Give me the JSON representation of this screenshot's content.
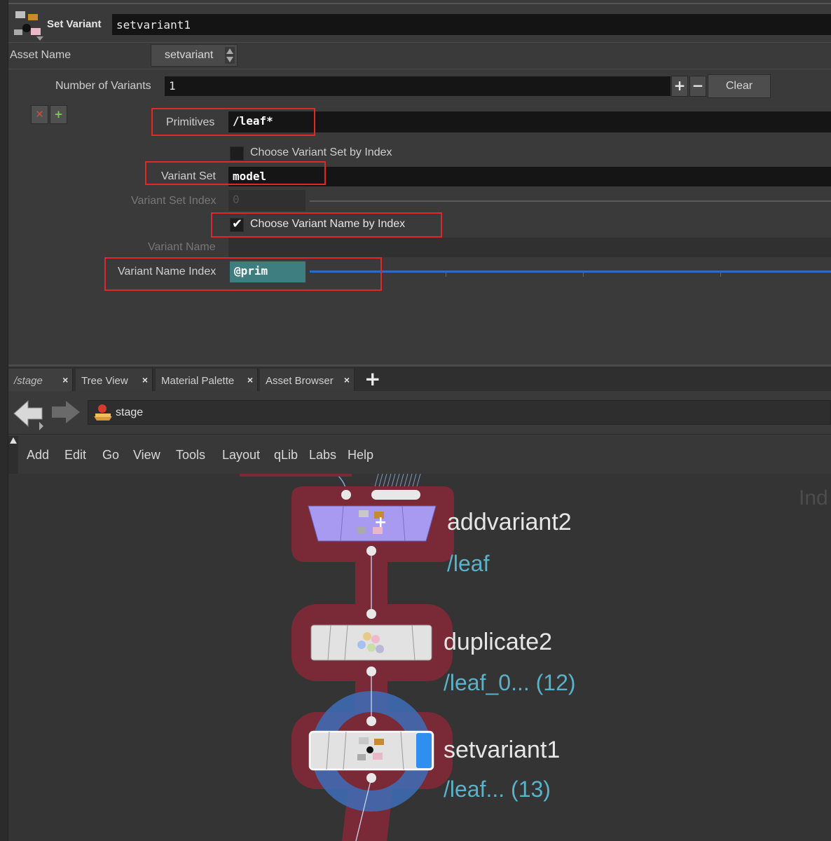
{
  "param_pane": {
    "node_type": "Set Variant",
    "node_name": "setvariant1",
    "asset_name_label": "Asset Name",
    "asset_name_value": "setvariant",
    "num_variants_label": "Number of Variants",
    "num_variants_value": "1",
    "plus_label": "+",
    "minus_label": "−",
    "clear_label": "Clear",
    "remove_icon": "✕",
    "insert_icon": "+",
    "primitives_label": "Primitives",
    "primitives_value": "/leaf*",
    "choose_set_by_index_label": "Choose Variant Set by Index",
    "choose_set_by_index_checked": false,
    "variant_set_label": "Variant Set",
    "variant_set_value": "model",
    "variant_set_index_label": "Variant Set Index",
    "variant_set_index_value": "0",
    "choose_name_by_index_label": "Choose Variant Name by Index",
    "choose_name_by_index_checked": true,
    "variant_name_label": "Variant Name",
    "variant_name_value": "",
    "variant_name_index_label": "Variant Name Index",
    "variant_name_index_value": "@prim"
  },
  "tabs": [
    {
      "label": "/stage",
      "active": true
    },
    {
      "label": "Tree View",
      "active": false
    },
    {
      "label": "Material Palette",
      "active": false
    },
    {
      "label": "Asset Browser",
      "active": false
    }
  ],
  "tab_close": "×",
  "tab_add": "+",
  "path": {
    "current": "stage"
  },
  "menu": [
    "Add",
    "Edit",
    "Go",
    "View",
    "Tools",
    "Layout",
    "qLib",
    "Labs",
    "Help"
  ],
  "network": {
    "corner_text": "Ind",
    "nodes": [
      {
        "name": "addvariant2",
        "path": "/leaf",
        "color": "#a89af0"
      },
      {
        "name": "duplicate2",
        "path": "/leaf_0... (12)",
        "color": "#e0e0e0"
      },
      {
        "name": "setvariant1",
        "path": "/leaf... (13)",
        "color": "#e0e0e0",
        "display_flag_color": "#2f8ff0"
      }
    ]
  },
  "colors": {
    "highlight_box": "#e0282a",
    "path_text": "#5ab2c8",
    "error_halo": "#7a2a36",
    "selection_halo": "#3d6fb8"
  }
}
